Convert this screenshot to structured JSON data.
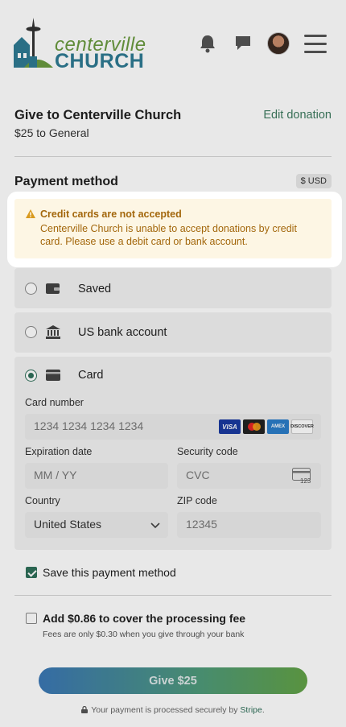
{
  "header": {
    "logo_line1": "centerville",
    "logo_line2": "CHURCH"
  },
  "donation": {
    "title": "Give to Centerville Church",
    "summary": "$25 to General",
    "edit_label": "Edit donation"
  },
  "payment": {
    "title": "Payment method",
    "currency_badge": "$ USD",
    "alert": {
      "title": "Credit cards are not accepted",
      "body": "Centerville Church is unable to accept donations by credit card. Please use a debit card or bank account."
    },
    "options": [
      {
        "label": "Saved",
        "selected": false,
        "icon": "wallet-icon"
      },
      {
        "label": "US bank account",
        "selected": false,
        "icon": "bank-icon"
      },
      {
        "label": "Card",
        "selected": true,
        "icon": "card-icon"
      }
    ],
    "card_form": {
      "card_number_label": "Card number",
      "card_number_placeholder": "1234 1234 1234 1234",
      "brands": [
        "VISA",
        "MC",
        "AMEX",
        "DISCOVER"
      ],
      "expiry_label": "Expiration date",
      "expiry_placeholder": "MM / YY",
      "cvc_label": "Security code",
      "cvc_placeholder": "CVC",
      "cvc_icon_text": "123",
      "country_label": "Country",
      "country_value": "United States",
      "zip_label": "ZIP code",
      "zip_placeholder": "12345"
    },
    "save_method_label": "Save this payment method",
    "save_method_checked": true,
    "fee_label": "Add $0.86 to cover the processing fee",
    "fee_checked": false,
    "fee_note": "Fees are only $0.30 when you give through your bank"
  },
  "actions": {
    "give_label": "Give $25",
    "secure_prefix": "Your payment is processed securely by ",
    "secure_brand": "Stripe",
    "secure_suffix": "."
  },
  "colors": {
    "accent": "#2f6f59",
    "alert_text": "#a3670c",
    "alert_bg": "#fdf6e4"
  }
}
